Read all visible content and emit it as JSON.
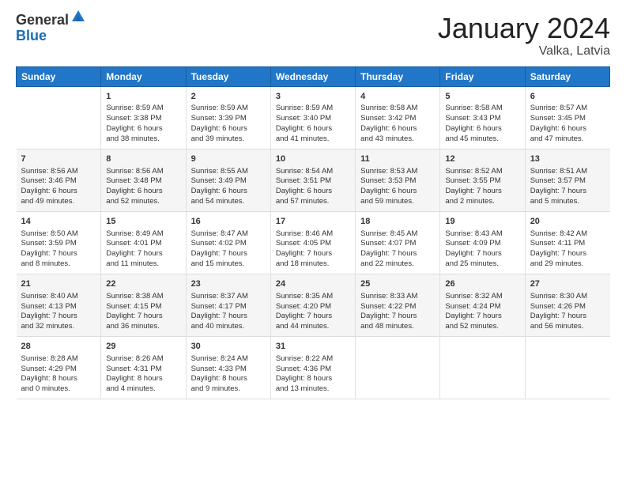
{
  "logo": {
    "general": "General",
    "blue": "Blue"
  },
  "title": "January 2024",
  "location": "Valka, Latvia",
  "days_header": [
    "Sunday",
    "Monday",
    "Tuesday",
    "Wednesday",
    "Thursday",
    "Friday",
    "Saturday"
  ],
  "weeks": [
    [
      {
        "day": "",
        "info": ""
      },
      {
        "day": "1",
        "info": "Sunrise: 8:59 AM\nSunset: 3:38 PM\nDaylight: 6 hours\nand 38 minutes."
      },
      {
        "day": "2",
        "info": "Sunrise: 8:59 AM\nSunset: 3:39 PM\nDaylight: 6 hours\nand 39 minutes."
      },
      {
        "day": "3",
        "info": "Sunrise: 8:59 AM\nSunset: 3:40 PM\nDaylight: 6 hours\nand 41 minutes."
      },
      {
        "day": "4",
        "info": "Sunrise: 8:58 AM\nSunset: 3:42 PM\nDaylight: 6 hours\nand 43 minutes."
      },
      {
        "day": "5",
        "info": "Sunrise: 8:58 AM\nSunset: 3:43 PM\nDaylight: 6 hours\nand 45 minutes."
      },
      {
        "day": "6",
        "info": "Sunrise: 8:57 AM\nSunset: 3:45 PM\nDaylight: 6 hours\nand 47 minutes."
      }
    ],
    [
      {
        "day": "7",
        "info": "Sunrise: 8:56 AM\nSunset: 3:46 PM\nDaylight: 6 hours\nand 49 minutes."
      },
      {
        "day": "8",
        "info": "Sunrise: 8:56 AM\nSunset: 3:48 PM\nDaylight: 6 hours\nand 52 minutes."
      },
      {
        "day": "9",
        "info": "Sunrise: 8:55 AM\nSunset: 3:49 PM\nDaylight: 6 hours\nand 54 minutes."
      },
      {
        "day": "10",
        "info": "Sunrise: 8:54 AM\nSunset: 3:51 PM\nDaylight: 6 hours\nand 57 minutes."
      },
      {
        "day": "11",
        "info": "Sunrise: 8:53 AM\nSunset: 3:53 PM\nDaylight: 6 hours\nand 59 minutes."
      },
      {
        "day": "12",
        "info": "Sunrise: 8:52 AM\nSunset: 3:55 PM\nDaylight: 7 hours\nand 2 minutes."
      },
      {
        "day": "13",
        "info": "Sunrise: 8:51 AM\nSunset: 3:57 PM\nDaylight: 7 hours\nand 5 minutes."
      }
    ],
    [
      {
        "day": "14",
        "info": "Sunrise: 8:50 AM\nSunset: 3:59 PM\nDaylight: 7 hours\nand 8 minutes."
      },
      {
        "day": "15",
        "info": "Sunrise: 8:49 AM\nSunset: 4:01 PM\nDaylight: 7 hours\nand 11 minutes."
      },
      {
        "day": "16",
        "info": "Sunrise: 8:47 AM\nSunset: 4:02 PM\nDaylight: 7 hours\nand 15 minutes."
      },
      {
        "day": "17",
        "info": "Sunrise: 8:46 AM\nSunset: 4:05 PM\nDaylight: 7 hours\nand 18 minutes."
      },
      {
        "day": "18",
        "info": "Sunrise: 8:45 AM\nSunset: 4:07 PM\nDaylight: 7 hours\nand 22 minutes."
      },
      {
        "day": "19",
        "info": "Sunrise: 8:43 AM\nSunset: 4:09 PM\nDaylight: 7 hours\nand 25 minutes."
      },
      {
        "day": "20",
        "info": "Sunrise: 8:42 AM\nSunset: 4:11 PM\nDaylight: 7 hours\nand 29 minutes."
      }
    ],
    [
      {
        "day": "21",
        "info": "Sunrise: 8:40 AM\nSunset: 4:13 PM\nDaylight: 7 hours\nand 32 minutes."
      },
      {
        "day": "22",
        "info": "Sunrise: 8:38 AM\nSunset: 4:15 PM\nDaylight: 7 hours\nand 36 minutes."
      },
      {
        "day": "23",
        "info": "Sunrise: 8:37 AM\nSunset: 4:17 PM\nDaylight: 7 hours\nand 40 minutes."
      },
      {
        "day": "24",
        "info": "Sunrise: 8:35 AM\nSunset: 4:20 PM\nDaylight: 7 hours\nand 44 minutes."
      },
      {
        "day": "25",
        "info": "Sunrise: 8:33 AM\nSunset: 4:22 PM\nDaylight: 7 hours\nand 48 minutes."
      },
      {
        "day": "26",
        "info": "Sunrise: 8:32 AM\nSunset: 4:24 PM\nDaylight: 7 hours\nand 52 minutes."
      },
      {
        "day": "27",
        "info": "Sunrise: 8:30 AM\nSunset: 4:26 PM\nDaylight: 7 hours\nand 56 minutes."
      }
    ],
    [
      {
        "day": "28",
        "info": "Sunrise: 8:28 AM\nSunset: 4:29 PM\nDaylight: 8 hours\nand 0 minutes."
      },
      {
        "day": "29",
        "info": "Sunrise: 8:26 AM\nSunset: 4:31 PM\nDaylight: 8 hours\nand 4 minutes."
      },
      {
        "day": "30",
        "info": "Sunrise: 8:24 AM\nSunset: 4:33 PM\nDaylight: 8 hours\nand 9 minutes."
      },
      {
        "day": "31",
        "info": "Sunrise: 8:22 AM\nSunset: 4:36 PM\nDaylight: 8 hours\nand 13 minutes."
      },
      {
        "day": "",
        "info": ""
      },
      {
        "day": "",
        "info": ""
      },
      {
        "day": "",
        "info": ""
      }
    ]
  ]
}
